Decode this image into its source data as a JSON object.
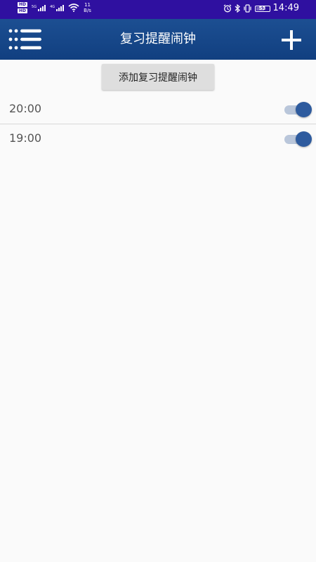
{
  "status_bar": {
    "hd1": "HD",
    "hd2": "HD",
    "sim1_label": "5G",
    "sim2_label": "4G",
    "netspeed_value": "11",
    "netspeed_unit": "B/s",
    "battery": "53",
    "time": "14:49"
  },
  "app_bar": {
    "title": "复习提醒闹钟",
    "menu_icon": "list-icon",
    "add_icon": "plus-icon"
  },
  "add_button_label": "添加复习提醒闹钟",
  "alarms": [
    {
      "time": "20:00",
      "enabled": true
    },
    {
      "time": "19:00",
      "enabled": true
    }
  ],
  "colors": {
    "status_bar": "#2f10a0",
    "app_bar": "#1a4a8c",
    "toggle_on": "#2e5b9e",
    "toggle_track": "#b9c6da",
    "background": "#fafafa"
  }
}
